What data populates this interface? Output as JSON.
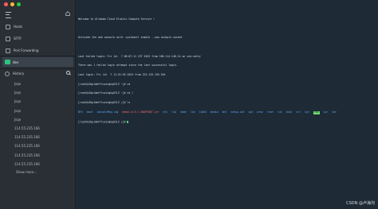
{
  "colors": {
    "sidebar_bg": "#2a2f36",
    "terminal_bg": "#1e2b36",
    "accent": "#2ec27e",
    "close": "#ff5f57",
    "minimize": "#febc2e",
    "zoom": "#28c840"
  },
  "sidebar": {
    "nav": [
      {
        "label": "Hosts",
        "icon": "hosts-icon"
      },
      {
        "label": "SFTP",
        "icon": "sftp-icon"
      },
      {
        "label": "Port Forwarding",
        "icon": "port-forwarding-icon"
      }
    ],
    "active_tab": {
      "label": "dev",
      "icon": "terminal-tab-icon"
    },
    "history": {
      "label": "History",
      "items": [
        "Jsqn",
        "Jsqn",
        "Jsqn",
        "Jsqn",
        "Jsqn",
        "114.55.235.166",
        "114.55.235.166",
        "114.55.235.166",
        "114.55.235.166",
        "114.55.235.166"
      ],
      "show_more": "Show more..."
    }
  },
  "terminal": {
    "lines": [
      "Welcome to Alibaba Cloud Elastic Compute Service !",
      "",
      "Activate the web console with: systemctl enable --now cockpit.socket",
      "",
      "Last failed login: Fri Jul  7 08:07:11 CST 2023 from 180.114.140.14 on ssh:notty",
      "There was 1 failed login attempt since the last successful login.",
      "Last login: Fri Jul  7 11:51:56 2023 from 223.153.155.204",
      "[root@iZbp1dmfftuzinghg53lZ ~]# cd",
      "[root@iZbp1dmfftuzinghg53lZ ~]# cd /",
      "[root@iZbp1dmfftuzinghg53lZ /]# ls"
    ],
    "ls_output": [
      {
        "name": "Bfe",
        "style": ""
      },
      {
        "name": "boot",
        "style": ""
      },
      {
        "name": "consoleMsg.log",
        "style": ""
      },
      {
        "name": "demo1-0.0.1-SNAPSHOT.jar",
        "style": "red"
      },
      {
        "name": "etc",
        "style": ""
      },
      {
        "name": "lib",
        "style": ""
      },
      {
        "name": "home",
        "style": ""
      },
      {
        "name": "lib",
        "style": ""
      },
      {
        "name": "lib64",
        "style": ""
      },
      {
        "name": "media",
        "style": ""
      },
      {
        "name": "mnt",
        "style": ""
      },
      {
        "name": "nohup.out",
        "style": ""
      },
      {
        "name": "opt",
        "style": ""
      },
      {
        "name": "proc",
        "style": ""
      },
      {
        "name": "root",
        "style": ""
      },
      {
        "name": "run",
        "style": ""
      },
      {
        "name": "sbin",
        "style": ""
      },
      {
        "name": "srv",
        "style": ""
      },
      {
        "name": "sys",
        "style": ""
      },
      {
        "name": "tmp",
        "style": "hl"
      },
      {
        "name": "usr",
        "style": ""
      },
      {
        "name": "var",
        "style": ""
      }
    ],
    "prompt": "[root@iZbp1dmfftuzinghg53lZ /]# "
  },
  "watermark": "CSDN @卢海沟"
}
